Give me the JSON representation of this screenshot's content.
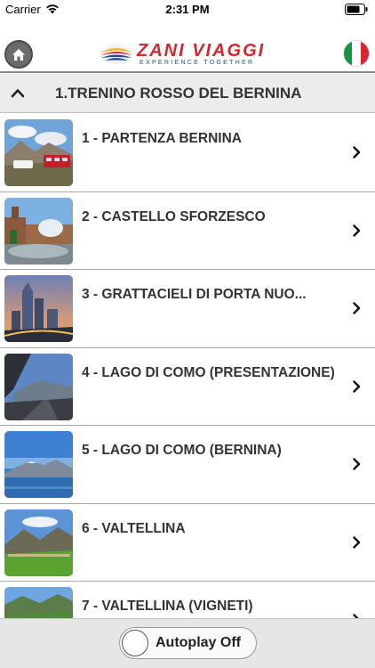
{
  "status_bar": {
    "carrier": "Carrier",
    "time": "2:31 PM",
    "wifi_icon": "wifi-icon",
    "battery_icon": "battery-icon"
  },
  "header": {
    "home_icon": "home-icon",
    "logo_title": "ZANI VIAGGI",
    "logo_tagline": "EXPERIENCE TOGETHER",
    "language_flag": "italy-flag-icon",
    "colors": {
      "brand_red": "#d8262f",
      "brand_blue": "#1a4fa3"
    }
  },
  "section": {
    "title": "1.TRENINO ROSSO DEL BERNINA",
    "collapse_icon": "chevron-up-icon"
  },
  "stops": [
    {
      "label": "1 - PARTENZA BERNINA",
      "thumbnail": "red-train-mountains-photo"
    },
    {
      "label": "2 - CASTELLO SFORZESCO",
      "thumbnail": "castle-fountain-photo"
    },
    {
      "label": "3 - GRATTACIELI DI PORTA NUO...",
      "thumbnail": "skyscrapers-dusk-photo"
    },
    {
      "label": "4 - LAGO DI COMO (PRESENTAZIONE)",
      "thumbnail": "lake-road-view-photo"
    },
    {
      "label": "5 - LAGO DI COMO (BERNINA)",
      "thumbnail": "lake-mountain-photo"
    },
    {
      "label": "6 - VALTELLINA",
      "thumbnail": "valley-meadow-photo"
    },
    {
      "label": "7 - VALTELLINA (VIGNETI)",
      "thumbnail": "vineyard-hills-photo"
    }
  ],
  "footer": {
    "autoplay_label": "Autoplay Off",
    "autoplay_on": false
  }
}
